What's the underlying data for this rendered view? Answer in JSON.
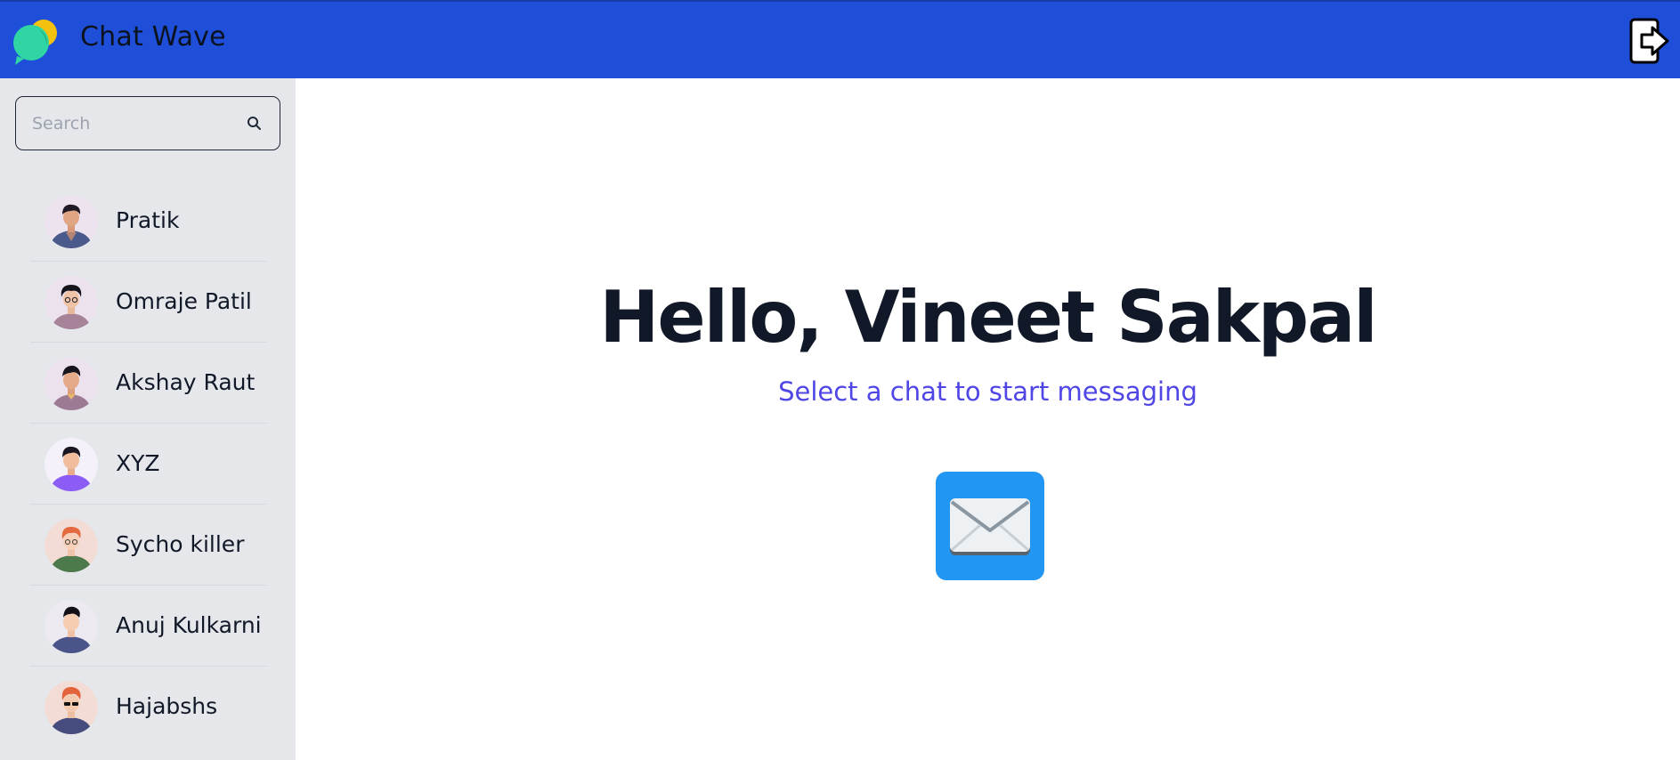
{
  "header": {
    "app_title": "Chat Wave",
    "logo_icon": "chat-bubbles-logo",
    "logout_icon": "logout-icon",
    "brand_color": "#1f4fd9"
  },
  "sidebar": {
    "search": {
      "placeholder": "Search",
      "value": "",
      "icon": "search-icon"
    },
    "contacts": [
      {
        "name": "Pratik",
        "avatar": "avatar-man-dark-hair"
      },
      {
        "name": "Omraje Patil",
        "avatar": "avatar-man-curly-hair"
      },
      {
        "name": "Akshay Raut",
        "avatar": "avatar-man-mauve-shirt"
      },
      {
        "name": "XYZ",
        "avatar": "avatar-man-purple-shirt"
      },
      {
        "name": "Sycho killer",
        "avatar": "avatar-redhead-green-shirt"
      },
      {
        "name": "Anuj Kulkarni",
        "avatar": "avatar-man-navy-shirt"
      },
      {
        "name": "Hajabshs",
        "avatar": "avatar-redhead-sunglasses"
      }
    ]
  },
  "main": {
    "greeting": "Hello, Vineet Sakpal",
    "subtitle": "Select a chat to start messaging",
    "center_icon": "mail-icon",
    "accent_color": "#4f46e5"
  }
}
